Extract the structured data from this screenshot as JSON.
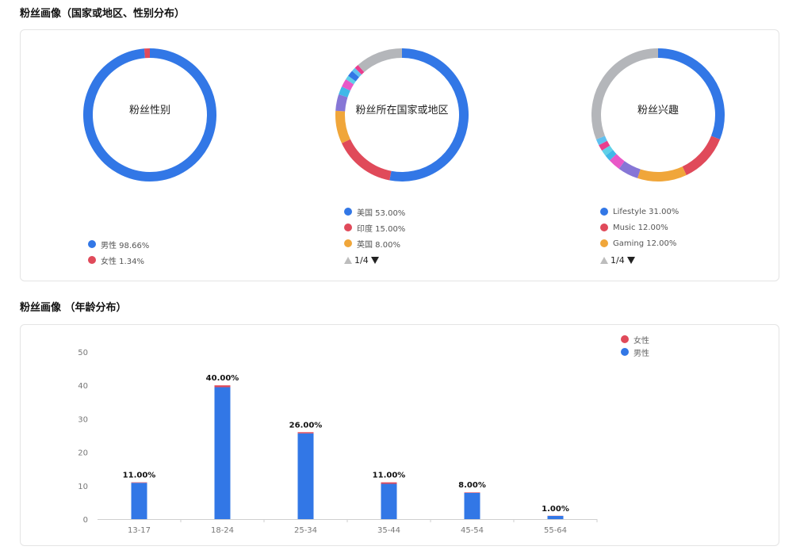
{
  "section1": {
    "title": "粉丝画像（国家或地区、性别分布）"
  },
  "section2": {
    "title": "粉丝画像 （年龄分布）"
  },
  "colors": {
    "blue": "#3277e6",
    "red": "#e04a5a",
    "orange": "#f0a63a",
    "gray": "#b4b6ba"
  },
  "chart_data": [
    {
      "type": "pie",
      "title": "粉丝性别",
      "slices": [
        {
          "label": "男性",
          "value": 98.66,
          "color": "#3277e6"
        },
        {
          "label": "女性",
          "value": 1.34,
          "color": "#e04a5a"
        }
      ],
      "legend": [
        {
          "label": "男性 98.66%",
          "color": "#3277e6"
        },
        {
          "label": "女性 1.34%",
          "color": "#e04a5a"
        }
      ]
    },
    {
      "type": "pie",
      "title": "粉丝所在国家或地区",
      "slices": [
        {
          "label": "美国",
          "value": 53.0,
          "color": "#3277e6"
        },
        {
          "label": "印度",
          "value": 15.0,
          "color": "#e04a5a"
        },
        {
          "label": "英国",
          "value": 8.0,
          "color": "#f0a63a"
        },
        {
          "value": 4.0,
          "color": "#8676d6"
        },
        {
          "value": 2.0,
          "color": "#40b8e8"
        },
        {
          "value": 2.0,
          "color": "#e858c8"
        },
        {
          "value": 1.0,
          "color": "#5fd0e8"
        },
        {
          "value": 1.5,
          "color": "#3277e6"
        },
        {
          "value": 1.0,
          "color": "#60c0f0"
        },
        {
          "value": 1.0,
          "color": "#ea3d8e"
        },
        {
          "value": 11.5,
          "color": "#b4b6ba"
        }
      ],
      "legend": [
        {
          "label": "美国 53.00%",
          "color": "#3277e6"
        },
        {
          "label": "印度 15.00%",
          "color": "#e04a5a"
        },
        {
          "label": "英国 8.00%",
          "color": "#f0a63a"
        }
      ],
      "pager": "1/4"
    },
    {
      "type": "pie",
      "title": "粉丝兴趣",
      "slices": [
        {
          "label": "Lifestyle",
          "value": 31.0,
          "color": "#3277e6"
        },
        {
          "label": "Music",
          "value": 12.0,
          "color": "#e04a5a"
        },
        {
          "label": "Gaming",
          "value": 12.0,
          "color": "#f0a63a"
        },
        {
          "value": 5.0,
          "color": "#8676d6"
        },
        {
          "value": 3.0,
          "color": "#e858c8"
        },
        {
          "value": 1.5,
          "color": "#40b8e8"
        },
        {
          "value": 1.5,
          "color": "#5fd0e8"
        },
        {
          "value": 1.5,
          "color": "#ea3d8e"
        },
        {
          "value": 1.5,
          "color": "#60c0f0"
        },
        {
          "value": 31.0,
          "color": "#b4b6ba"
        }
      ],
      "legend": [
        {
          "label": "Lifestyle 31.00%",
          "color": "#3277e6"
        },
        {
          "label": "Music 12.00%",
          "color": "#e04a5a"
        },
        {
          "label": "Gaming 12.00%",
          "color": "#f0a63a"
        }
      ],
      "pager": "1/4"
    },
    {
      "type": "bar",
      "stacked": true,
      "categories": [
        "13-17",
        "18-24",
        "25-34",
        "35-44",
        "45-54",
        "55-64"
      ],
      "series": [
        {
          "name": "男性",
          "color": "#3277e6",
          "values": [
            10.85,
            39.45,
            25.65,
            10.55,
            7.85,
            0.95
          ]
        },
        {
          "name": "女性",
          "color": "#e04a5a",
          "values": [
            0.15,
            0.55,
            0.35,
            0.45,
            0.15,
            0.05
          ]
        }
      ],
      "data_labels": [
        "11.00%",
        "40.00%",
        "26.00%",
        "11.00%",
        "8.00%",
        "1.00%"
      ],
      "yticks": [
        0,
        10,
        20,
        30,
        40,
        50
      ],
      "ylim": [
        0,
        50
      ],
      "legend": [
        {
          "label": "女性",
          "color": "#e04a5a"
        },
        {
          "label": "男性",
          "color": "#3277e6"
        }
      ]
    }
  ]
}
